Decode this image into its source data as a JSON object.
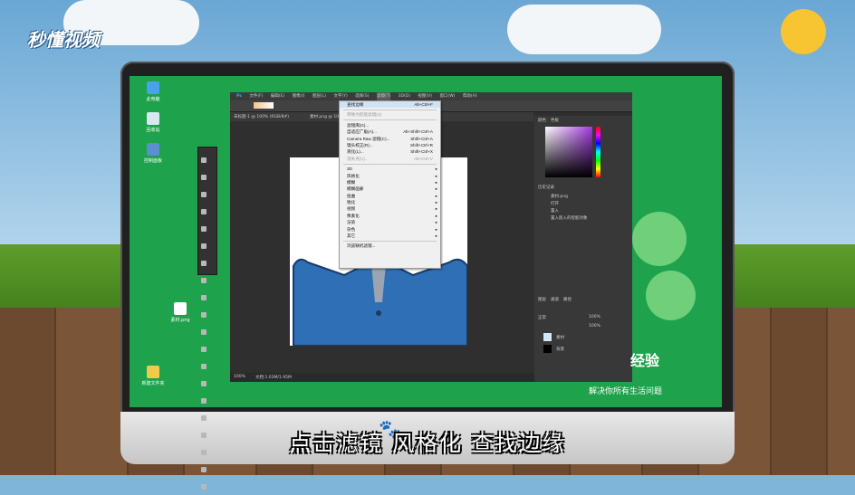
{
  "watermark_logo": "秒懂视频",
  "subtitle": "点击滤镜 风格化 查找边缘",
  "brand": {
    "name": "经验",
    "tagline": "解决你所有生活问题"
  },
  "desktop_icons": [
    {
      "label": "此电脑"
    },
    {
      "label": "回收站"
    },
    {
      "label": "控制面板"
    },
    {
      "label": "素材.png"
    },
    {
      "label": "新建文件夹"
    }
  ],
  "ps_menubar": [
    "文件(F)",
    "编辑(E)",
    "图像(I)",
    "图层(L)",
    "文字(Y)",
    "选择(S)",
    "滤镜(T)",
    "3D(D)",
    "视图(V)",
    "窗口(W)",
    "帮助(H)"
  ],
  "filter_menu": {
    "items": [
      {
        "label": "查找边缘",
        "shortcut": "Alt+Ctrl+F",
        "highlight": true
      },
      {
        "sep": true
      },
      {
        "label": "转换为智能滤镜(S)",
        "disabled": true
      },
      {
        "sep": true
      },
      {
        "label": "滤镜库(G)...",
        "shortcut": ""
      },
      {
        "label": "自适应广角(A)...",
        "shortcut": "Alt+Shift+Ctrl+A"
      },
      {
        "label": "Camera Raw 滤镜(C)...",
        "shortcut": "Shift+Ctrl+A"
      },
      {
        "label": "镜头校正(R)...",
        "shortcut": "Shift+Ctrl+R"
      },
      {
        "label": "液化(L)...",
        "shortcut": "Shift+Ctrl+X"
      },
      {
        "label": "消失点(V)...",
        "shortcut": "Alt+Ctrl+V",
        "disabled": true
      },
      {
        "sep": true
      },
      {
        "label": "3D",
        "submenu": true
      },
      {
        "label": "风格化",
        "submenu": true
      },
      {
        "label": "模糊",
        "submenu": true
      },
      {
        "label": "模糊画廊",
        "submenu": true
      },
      {
        "label": "扭曲",
        "submenu": true
      },
      {
        "label": "锐化",
        "submenu": true
      },
      {
        "label": "视频",
        "submenu": true
      },
      {
        "label": "像素化",
        "submenu": true
      },
      {
        "label": "渲染",
        "submenu": true
      },
      {
        "label": "杂色",
        "submenu": true
      },
      {
        "label": "其它",
        "submenu": true
      },
      {
        "sep": true
      },
      {
        "label": "浏览联机滤镜..."
      }
    ]
  },
  "ps_tabs": [
    "未标题-1 @ 100% (RGB/8#)",
    "素材.png @ 100% (RGB/8#)"
  ],
  "status": {
    "zoom": "100%",
    "doc": "文档:1.03M/1.95M"
  },
  "panels": {
    "color_tabs": [
      "颜色",
      "色板"
    ],
    "history_title": "历史记录",
    "history_items": [
      "素材.png",
      "打开",
      "置入",
      "置入嵌入的智能对象"
    ],
    "layers_tabs": [
      "图层",
      "通道",
      "路径"
    ],
    "layers": [
      {
        "name": "素材"
      },
      {
        "name": "背景"
      }
    ],
    "blend_mode": "正常",
    "opacity": "100%",
    "fill": "100%"
  },
  "colors": {
    "screen_green": "#1ea24b",
    "highlight": "#cfe3f5"
  }
}
